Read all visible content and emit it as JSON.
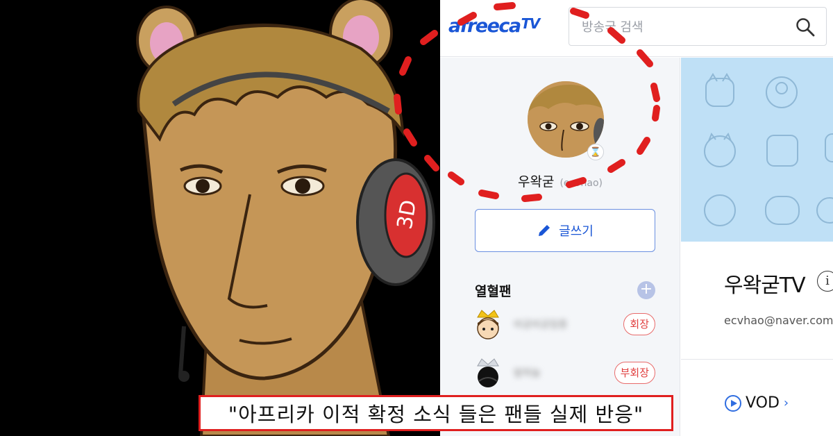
{
  "header": {
    "logo_text": "afreeca",
    "logo_tv": "TV",
    "search_placeholder": "방송국 검색",
    "search_icon": "search-icon"
  },
  "profile": {
    "name": "우왁굳",
    "id": "(ecvhao)",
    "badge_icon": "hourglass-icon"
  },
  "sidebar": {
    "write_label": "글쓰기",
    "write_icon": "pencil-icon",
    "fans_title": "열혈팬",
    "fans_add": "+",
    "fans": [
      {
        "name": "비공비공임중",
        "role": "회장"
      },
      {
        "name": "밤하늘",
        "role": "부회장"
      }
    ]
  },
  "channel": {
    "title": "우왁굳TV",
    "info_icon": "i",
    "email": "ecvhao@naver.com",
    "vod_label": "VOD",
    "vod_chevron": "›"
  },
  "caption": "\"아프리카 이적 확정 소식 들은 팬들 실제 반응\"",
  "colors": {
    "brand": "#1a56d6",
    "annotation_red": "#e01f1f",
    "banner_bg": "#bfe0f6"
  }
}
